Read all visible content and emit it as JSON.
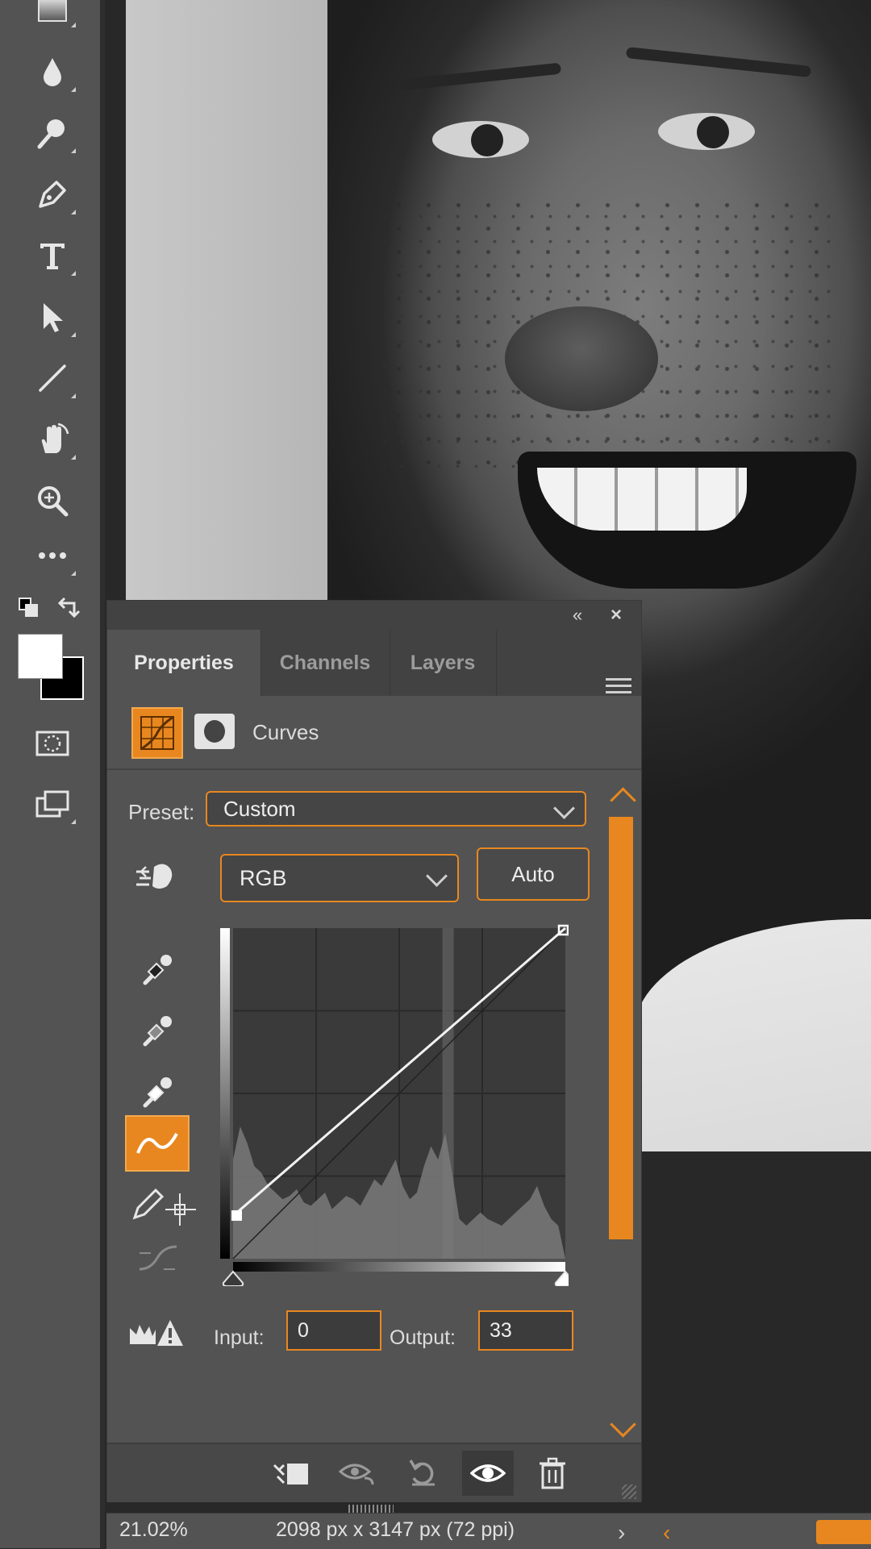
{
  "app": {
    "accent": "#e8871f",
    "panel_bg": "#535353"
  },
  "toolbar": {
    "tools": [
      {
        "icon": "gradient-icon"
      },
      {
        "icon": "blur-drop-icon"
      },
      {
        "icon": "dodge-icon"
      },
      {
        "icon": "pen-icon"
      },
      {
        "icon": "type-icon"
      },
      {
        "icon": "path-selection-icon"
      },
      {
        "icon": "line-icon"
      },
      {
        "icon": "hand-icon"
      },
      {
        "icon": "zoom-icon"
      },
      {
        "icon": "more-tools-icon"
      }
    ],
    "foreground_color": "#ffffff",
    "background_color": "#000000"
  },
  "panel": {
    "tabs": [
      {
        "label": "Properties",
        "active": true
      },
      {
        "label": "Channels",
        "active": false
      },
      {
        "label": "Layers",
        "active": false
      }
    ],
    "adjustment_title": "Curves",
    "preset_label": "Preset:",
    "preset_value": "Custom",
    "channel_value": "RGB",
    "auto_label": "Auto",
    "input_label": "Input:",
    "input_value": "0",
    "output_label": "Output:",
    "output_value": "33"
  },
  "curve": {
    "points": [
      [
        0,
        33
      ],
      [
        255,
        255
      ]
    ]
  },
  "status": {
    "zoom": "21.02%",
    "doc_info": "2098 px x 3147 px (72 ppi)"
  }
}
